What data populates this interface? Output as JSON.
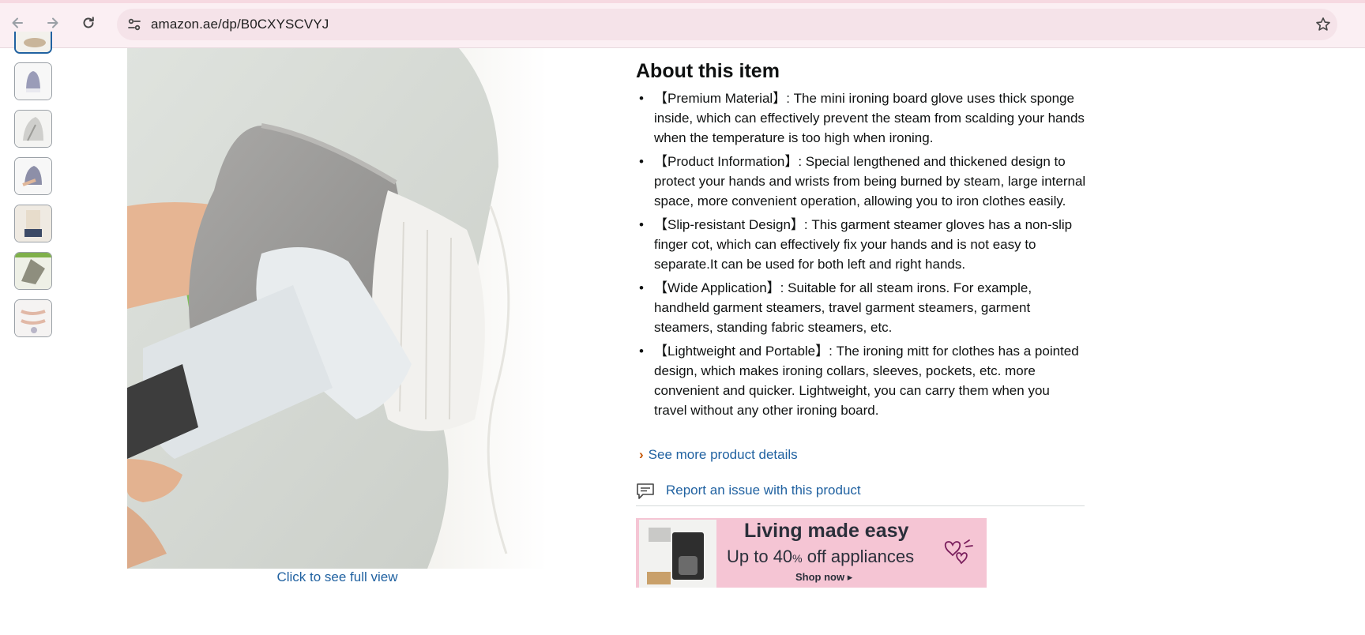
{
  "browser": {
    "url": "amazon.ae/dp/B0CXYSCVYJ",
    "back_icon": "arrow-left-icon",
    "forward_icon": "arrow-right-icon",
    "reload_icon": "reload-icon",
    "site_info_icon": "tune-icon",
    "bookmark_icon": "star-icon"
  },
  "gallery": {
    "thumbnails": [
      {
        "label": "thumbnail-1"
      },
      {
        "label": "thumbnail-2"
      },
      {
        "label": "thumbnail-3"
      },
      {
        "label": "thumbnail-4"
      },
      {
        "label": "thumbnail-5"
      },
      {
        "label": "thumbnail-6"
      },
      {
        "label": "thumbnail-7"
      }
    ],
    "full_view_label": "Click to see full view"
  },
  "about": {
    "title": "About this item",
    "bullets": [
      "【Premium Material】: The mini ironing board glove uses thick sponge inside, which can effectively prevent the steam from scalding your hands when the temperature is too high when ironing.",
      "【Product Information】: Special lengthened and thickened design to protect your hands and wrists from being burned by steam, large internal space, more convenient operation, allowing you to iron clothes easily.",
      "【Slip-resistant Design】: This garment steamer gloves has a non-slip finger cot, which can effectively fix your hands and is not easy to separate.It can be used for both left and right hands.",
      "【Wide Application】: Suitable for all steam irons. For example, handheld garment steamers, travel garment steamers, garment steamers, standing fabric steamers, etc.",
      "【Lightweight and Portable】: The ironing mitt for clothes has a pointed design, which makes ironing collars, sleeves, pockets, etc. more convenient and quicker. Lightweight, you can carry them when you travel without any other ironing board."
    ],
    "see_more": "See more product details",
    "report": "Report an issue with this product"
  },
  "ad": {
    "headline": "Living made easy",
    "offer_prefix": "Up to 40",
    "offer_percent": "%",
    "offer_suffix": " off appliances",
    "cta": "Shop now ▸"
  },
  "colors": {
    "link": "#2162a1",
    "chevron": "#c45500",
    "ad_background": "#f5c5d4",
    "chrome_background": "#fbeff3"
  }
}
